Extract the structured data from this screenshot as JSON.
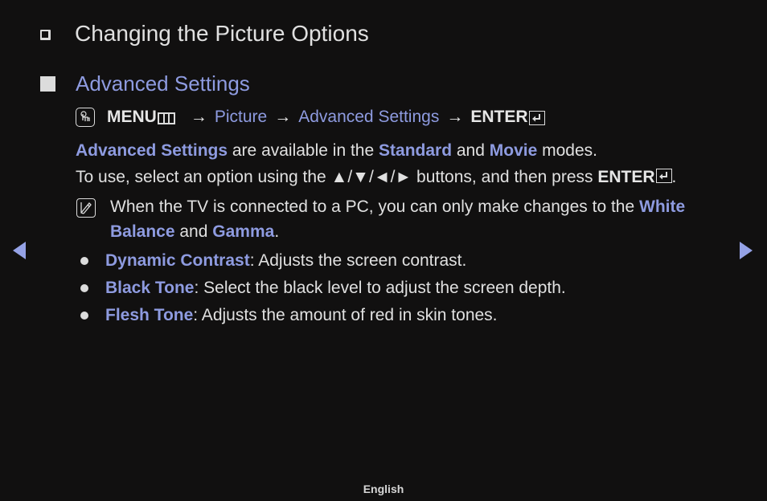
{
  "title": "Changing the Picture Options",
  "section": {
    "heading": "Advanced Settings"
  },
  "menu_path": {
    "icon": "o-remote-hand-icon",
    "menu_label": "MENU",
    "menu_icon": "menu-grid-icon",
    "arrow": "→",
    "step1": "Picture",
    "step2": "Advanced Settings",
    "enter_label": "ENTER",
    "enter_icon": "enter-return-icon"
  },
  "paragraph1": {
    "a": "Advanced Settings",
    "b": " are available in the ",
    "c": "Standard",
    "d": " and ",
    "e": "Movie",
    "f": " modes."
  },
  "paragraph2": {
    "a": "To use, select an option using the ▲/▼/◄/► buttons, and then press ",
    "b": "ENTER",
    "c": "."
  },
  "note": {
    "icon": "note-pen-icon",
    "line1_a": "When the TV is connected to a PC, you can only make changes to the ",
    "line1_b": "White",
    "line2_a": "Balance",
    "line2_b": " and ",
    "line2_c": "Gamma",
    "line2_d": "."
  },
  "bullets": [
    {
      "term": "Dynamic Contrast",
      "desc": ": Adjusts the screen contrast."
    },
    {
      "term": "Black Tone",
      "desc": ": Select the black level to adjust the screen depth."
    },
    {
      "term": "Flesh Tone",
      "desc": ": Adjusts the amount of red in skin tones."
    }
  ],
  "nav": {
    "prev_icon": "triangle-left-icon",
    "next_icon": "triangle-right-icon"
  },
  "footer": {
    "language": "English"
  },
  "colors": {
    "background": "#111010",
    "text": "#e0e0e0",
    "highlight": "#8e9be0"
  }
}
